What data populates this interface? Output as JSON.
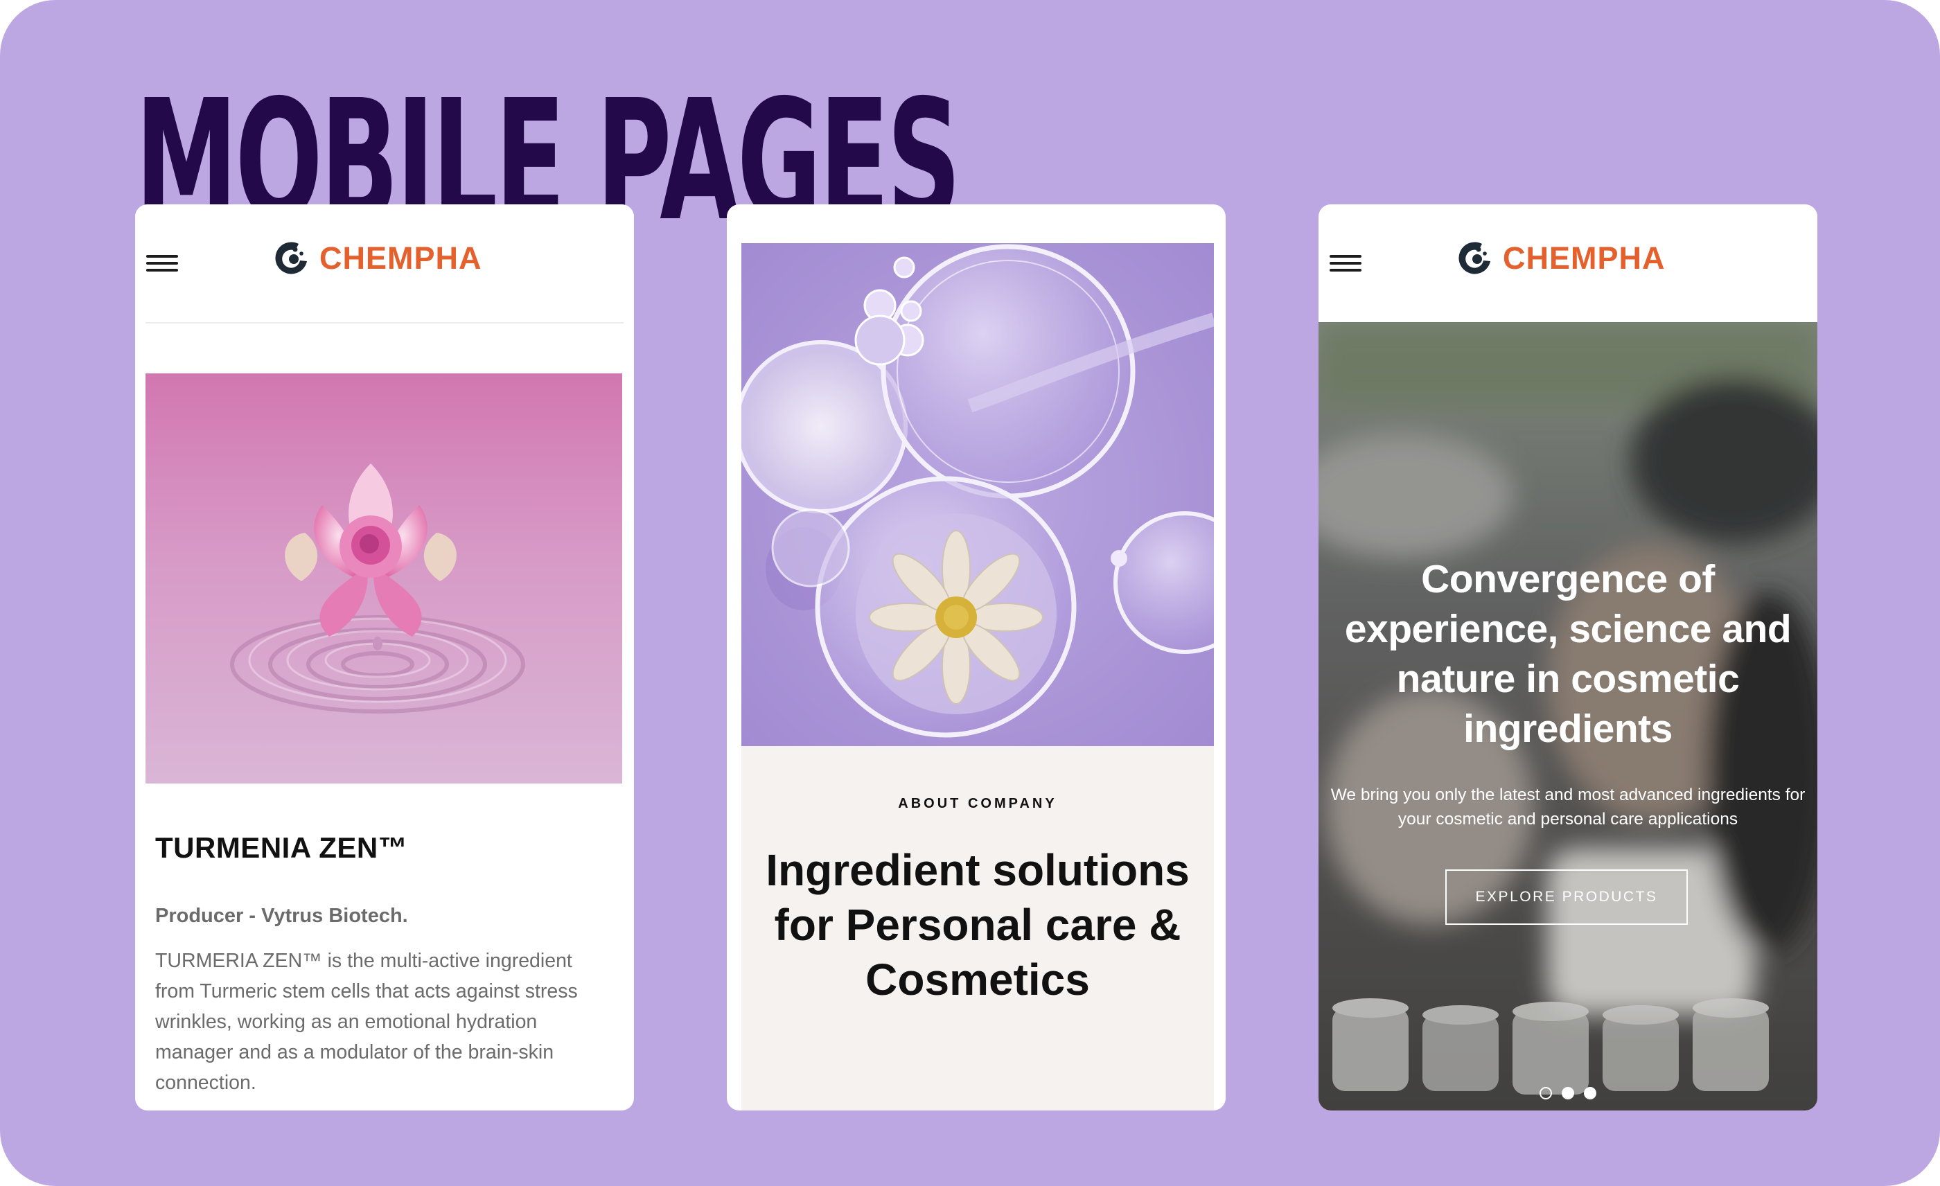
{
  "board": {
    "title": "MOBILE PAGES",
    "background": "#bca7e2",
    "title_color": "#24094a"
  },
  "brand": {
    "name": "CHEMPHA",
    "color": "#e4602c",
    "mark_color": "#1f2a37",
    "logo_icon": "chempha-logo-icon"
  },
  "icons": {
    "menu": "hamburger-menu-icon"
  },
  "product_page": {
    "title": "TURMENIA ZEN™",
    "producer": "Producer - Vytrus Biotech.",
    "description": "TURMERIA ZEN™ is the multi-active ingredient from Turmeric stem cells that acts against stress wrinkles, working as an emotional hydration manager and as a modulator of the brain-skin connection.",
    "image": "pink-flower-water-ripple-image"
  },
  "about_page": {
    "eyebrow": "ABOUT COMPANY",
    "heading": "Ingredient solutions for Personal care & Cosmetics",
    "image": "petri-dishes-flower-image"
  },
  "home_page": {
    "heading": "Convergence of experience, science and nature in cosmetic ingredients",
    "subheading": "We bring you only the latest and most advanced ingredients for your cosmetic and personal care applications",
    "cta_label": "EXPLORE PRODUCTS",
    "slides_total": 3,
    "active_slide": 1,
    "image": "lab-cosmetic-jars-image"
  }
}
